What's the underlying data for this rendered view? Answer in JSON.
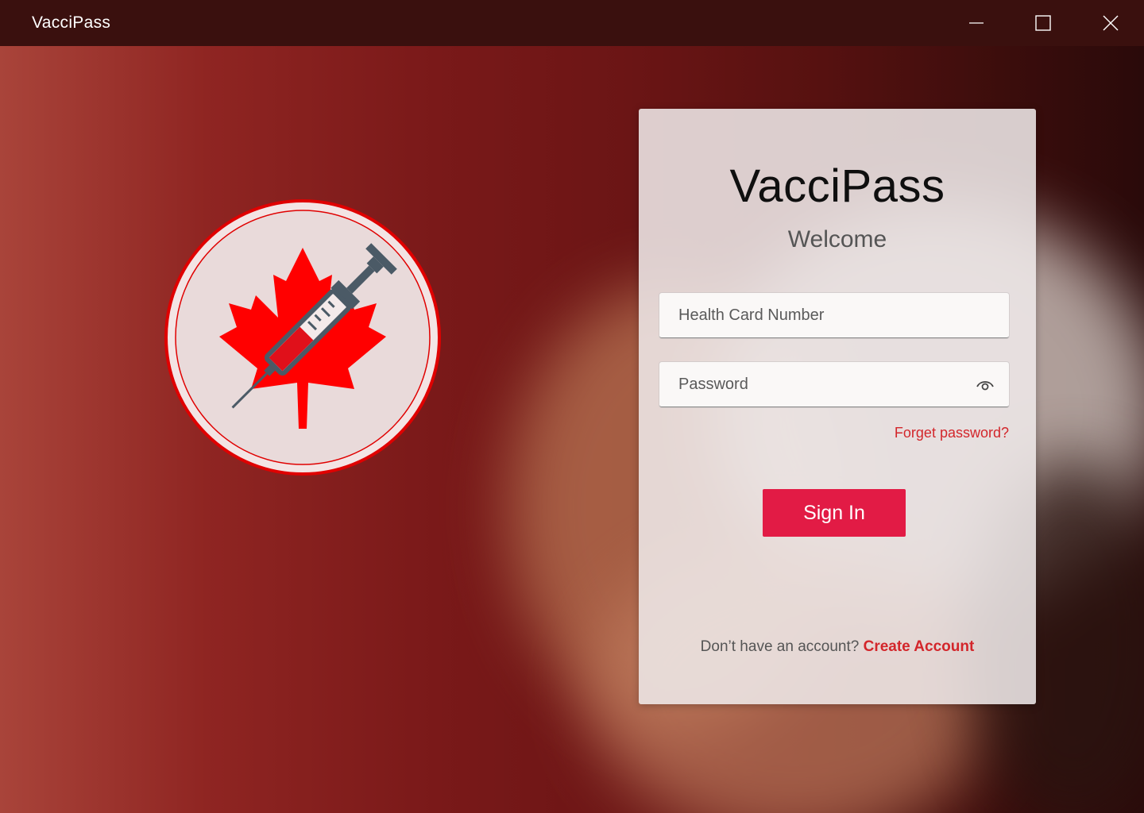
{
  "window": {
    "title": "VacciPass",
    "controls": [
      "minimize-icon",
      "maximize-icon",
      "close-icon"
    ]
  },
  "login": {
    "app_title": "VacciPass",
    "welcome": "Welcome",
    "health_card_placeholder": "Health Card Number",
    "password_placeholder": "Password",
    "forgot_password": "Forget password?",
    "sign_in": "Sign In",
    "no_account_text": "Don’t have an account?",
    "create_account": "Create Account"
  },
  "logo": {
    "icon": "maple-leaf-syringe-logo",
    "colors": {
      "maple": "#ff0000",
      "ring": "#e00000",
      "syringe_body": "#4b5a66",
      "fluid": "#e0101a"
    }
  },
  "colors": {
    "accent": "#e21b45",
    "link": "#d3262b",
    "titlebar": "#3a100e"
  }
}
